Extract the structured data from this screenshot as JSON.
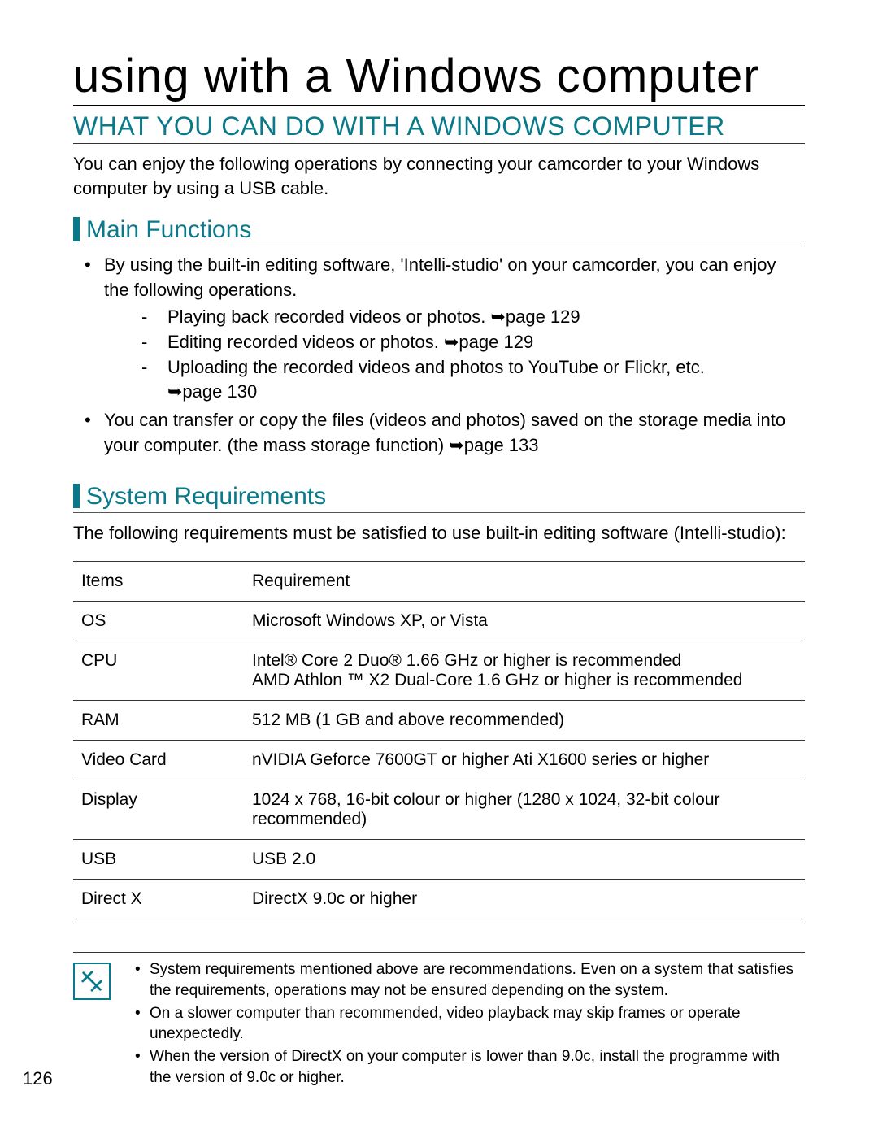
{
  "title": "using with a Windows computer",
  "heading": "WHAT YOU CAN DO WITH A WINDOWS COMPUTER",
  "intro": "You can enjoy the following operations by connecting your camcorder to your Windows computer by using a USB cable.",
  "section1_title": "Main Functions",
  "b1_text": "By using the built-in editing software, 'Intelli-studio' on your camcorder, you can enjoy the following operations.",
  "d1_text": "Playing back recorded videos or photos. ",
  "d1_ref": "➥page 129",
  "d2_text": "Editing recorded videos or photos. ",
  "d2_ref": "➥page 129",
  "d3_text": "Uploading the recorded videos and photos to YouTube or Flickr, etc.",
  "d3_ref": "➥page 130",
  "b2_text": "You can transfer or copy the files (videos and photos) saved on the storage media into your computer. (the mass storage function) ",
  "b2_ref": "➥page 133",
  "section2_title": "System Requirements",
  "req_intro": "The following requirements must be satisfied to use built-in editing software (Intelli-studio):",
  "table_head_1": "Items",
  "table_head_2": "Requirement",
  "r1_k": "OS",
  "r1_v": "Microsoft Windows XP, or Vista",
  "r2_k": "CPU",
  "r2_v": "Intel® Core 2 Duo® 1.66 GHz or higher is recommended\nAMD Athlon ™ X2 Dual-Core 1.6 GHz or higher is recommended",
  "r3_k": "RAM",
  "r3_v": "512 MB (1 GB and above recommended)",
  "r4_k": "Video Card",
  "r4_v": "nVIDIA Geforce 7600GT or higher Ati X1600 series or higher",
  "r5_k": "Display",
  "r5_v": "1024 x 768, 16-bit colour or higher (1280 x 1024, 32-bit colour recommended)",
  "r6_k": "USB",
  "r6_v": "USB 2.0",
  "r7_k": "Direct X",
  "r7_v": "DirectX 9.0c or higher",
  "n1": "System requirements mentioned above are recommendations. Even on a system that satisfies the requirements, operations may not be ensured depending on the system.",
  "n2": "On a slower computer than recommended, video playback may skip frames or operate unexpectedly.",
  "n3": "When the version of DirectX on your computer is lower than 9.0c, install the programme with the version of 9.0c or higher.",
  "page_number": "126"
}
